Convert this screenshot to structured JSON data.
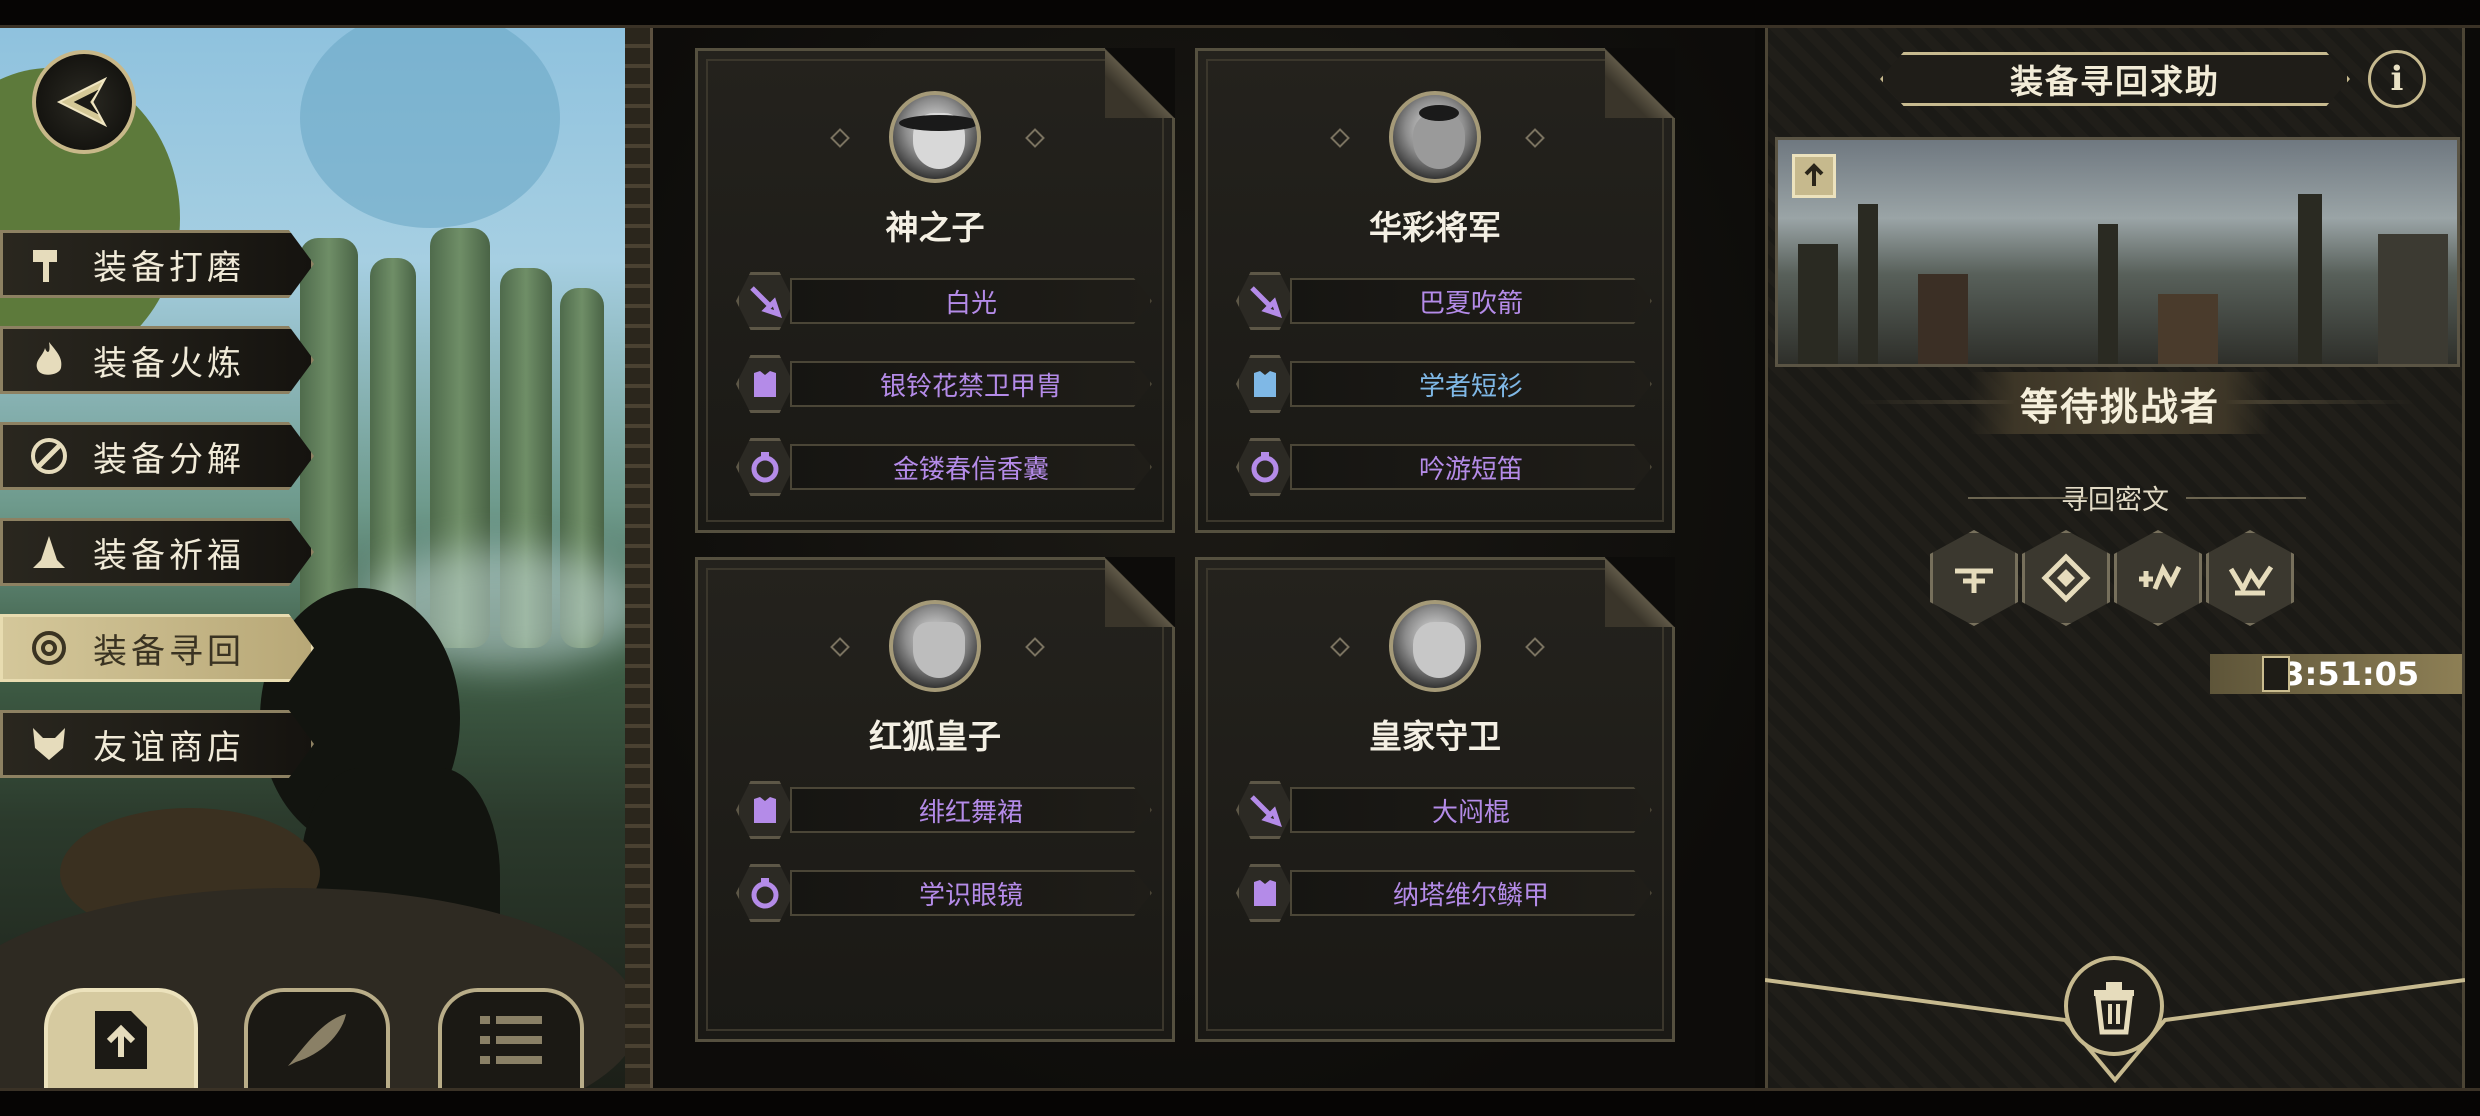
{
  "nav": {
    "menu": [
      {
        "label": "装备打磨",
        "icon": "hammer-icon",
        "active": false
      },
      {
        "label": "装备火炼",
        "icon": "flame-icon",
        "active": false
      },
      {
        "label": "装备分解",
        "icon": "disassemble-icon",
        "active": false
      },
      {
        "label": "装备祈福",
        "icon": "pray-hands-icon",
        "active": false
      },
      {
        "label": "装备寻回",
        "icon": "target-icon",
        "active": true
      },
      {
        "label": "友谊商店",
        "icon": "fox-icon",
        "active": false
      }
    ],
    "bottom_tools": [
      {
        "icon": "upload-icon",
        "active": true
      },
      {
        "icon": "feather-icon",
        "active": false
      },
      {
        "icon": "list-icon",
        "active": false
      }
    ]
  },
  "cards": [
    {
      "name": "神之子",
      "items": [
        {
          "label": "白光",
          "icon": "sword-icon",
          "color": "#b48be8"
        },
        {
          "label": "银铃花禁卫甲胄",
          "icon": "armor-icon",
          "color": "#b48be8"
        },
        {
          "label": "金镂春信香囊",
          "icon": "ring-icon",
          "color": "#b48be8"
        }
      ]
    },
    {
      "name": "华彩将军",
      "items": [
        {
          "label": "巴夏吹箭",
          "icon": "sword-icon",
          "color": "#b48be8"
        },
        {
          "label": "学者短衫",
          "icon": "armor-icon",
          "color": "#7fb8e6"
        },
        {
          "label": "吟游短笛",
          "icon": "ring-icon",
          "color": "#b48be8"
        }
      ]
    },
    {
      "name": "红狐皇子",
      "items": [
        {
          "label": "绯红舞裙",
          "icon": "armor-icon",
          "color": "#b48be8"
        },
        {
          "label": "学识眼镜",
          "icon": "ring-icon",
          "color": "#b48be8"
        }
      ]
    },
    {
      "name": "皇家守卫",
      "items": [
        {
          "label": "大闷棍",
          "icon": "sword-icon",
          "color": "#b48be8"
        },
        {
          "label": "纳塔维尔鳞甲",
          "icon": "armor-icon",
          "color": "#b48be8"
        }
      ]
    }
  ],
  "panel": {
    "title": "装备寻回求助",
    "info_label": "i",
    "status": "等待挑战者",
    "cipher_label": "寻回密文",
    "runes": [
      "rune-1-icon",
      "rune-2-icon",
      "rune-3-icon",
      "rune-4-icon"
    ],
    "timer": "23:51:05"
  },
  "colors": {
    "gold": "#c7ba8f",
    "purple": "#b48be8",
    "blue": "#7fb8e6"
  }
}
